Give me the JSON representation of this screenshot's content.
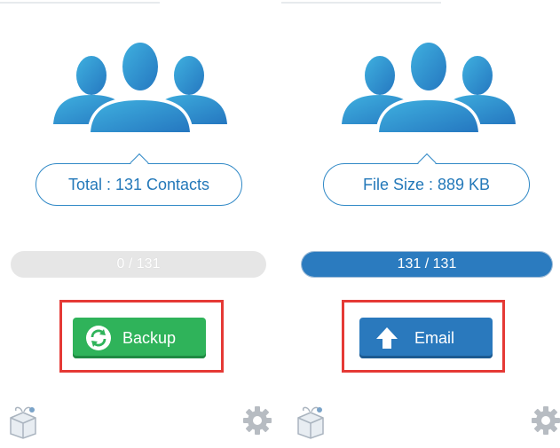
{
  "left_screen": {
    "bubble_text": "Total : 131 Contacts",
    "progress_text": "0 / 131",
    "progress_fraction": 0,
    "button_label": "Backup"
  },
  "right_screen": {
    "bubble_text": "File Size : 889 KB",
    "progress_text": "131 / 131",
    "progress_fraction": 1,
    "button_label": "Email"
  },
  "icons": {
    "people": "contacts-group-icon",
    "backup": "sync-icon",
    "email": "upload-arrow-icon",
    "gift": "gift-box-icon",
    "settings": "gear-icon"
  },
  "colors": {
    "accent_blue": "#2a79bd",
    "backup_green": "#2fb35a",
    "highlight_red": "#e53935",
    "progress_track": "#e6e6e6"
  }
}
